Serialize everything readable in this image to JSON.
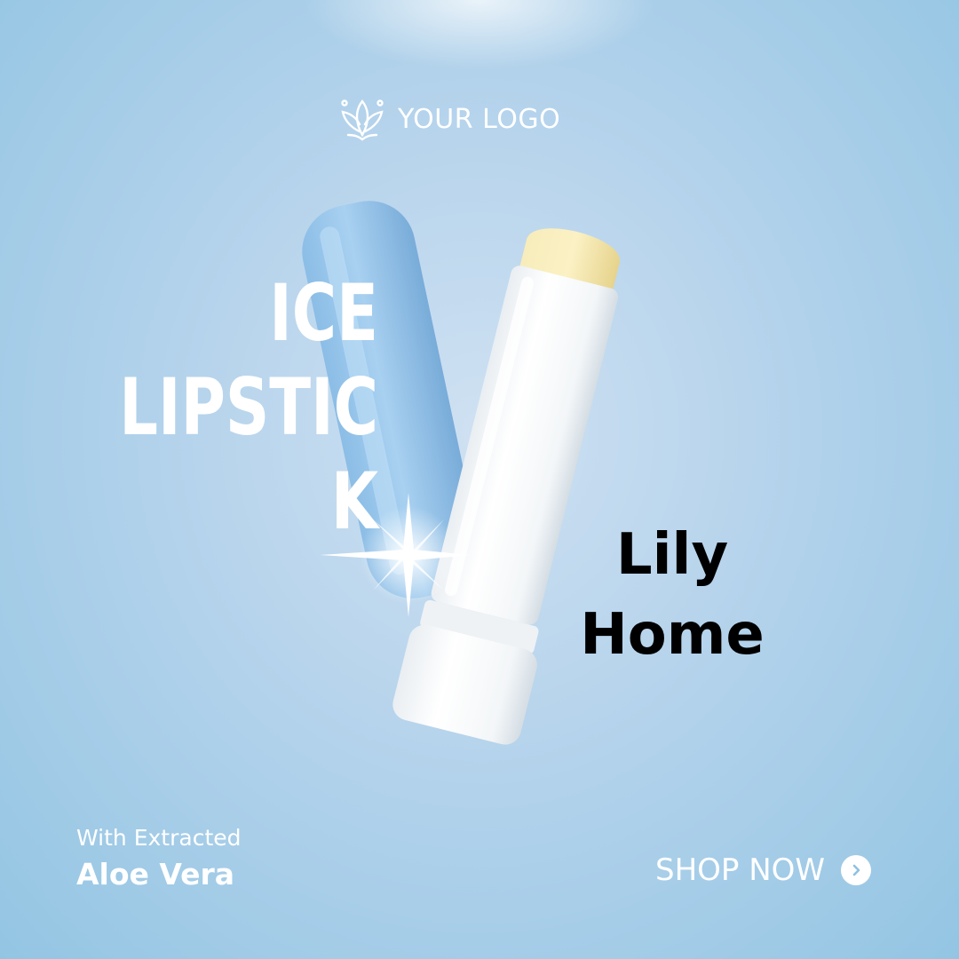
{
  "logo": {
    "text": "YOUR LOGO",
    "icon": "lotus-icon"
  },
  "headline": {
    "lines": [
      "ICE",
      "LIPSTIC",
      "K"
    ]
  },
  "brand": {
    "lines": [
      "Lily",
      "Home"
    ]
  },
  "tagline": {
    "sub": "With Extracted",
    "main": "Aloe Vera"
  },
  "cta": {
    "label": "SHOP NOW",
    "icon": "chevron-right-circle-icon"
  },
  "colors": {
    "background": "#b7d4ec",
    "text_light": "#ffffff",
    "text_dark": "#000000",
    "cap_blue": "#9cc8ec",
    "balm_yellow": "#f3e3a4"
  }
}
